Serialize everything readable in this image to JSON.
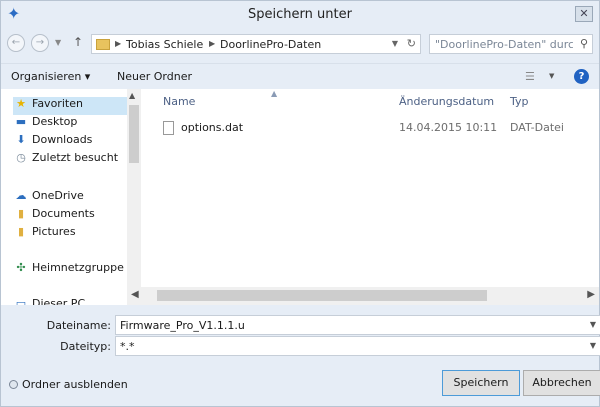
{
  "window": {
    "title": "Speichern unter",
    "close_glyph": "✕"
  },
  "nav": {
    "back_glyph": "←",
    "forward_glyph": "→",
    "up_glyph": "↑",
    "crumbs": [
      "Tobias Schiele",
      "DoorlinePro-Daten"
    ],
    "search_placeholder": "\"DoorlinePro-Daten\" durchsuc..."
  },
  "toolbar": {
    "organize_label": "Organisieren ▾",
    "new_folder_label": "Neuer Ordner"
  },
  "sidebar": {
    "items": [
      {
        "label": "Favoriten",
        "icon": "star-icon",
        "selected": true
      },
      {
        "label": "Desktop",
        "icon": "desktop-icon"
      },
      {
        "label": "Downloads",
        "icon": "downloads-icon"
      },
      {
        "label": "Zuletzt besucht",
        "icon": "recent-icon"
      },
      {
        "label": "OneDrive",
        "icon": "cloud-icon"
      },
      {
        "label": "Documents",
        "icon": "folder-icon"
      },
      {
        "label": "Pictures",
        "icon": "folder-icon"
      },
      {
        "label": "Heimnetzgruppe",
        "icon": "homegroup-icon"
      },
      {
        "label": "Dieser PC",
        "icon": "computer-icon"
      }
    ]
  },
  "files": {
    "columns": {
      "name": "Name",
      "date": "Änderungsdatum",
      "type": "Typ"
    },
    "rows": [
      {
        "name": "options.dat",
        "date": "14.04.2015 10:11",
        "type": "DAT-Datei"
      }
    ]
  },
  "form": {
    "filename_label": "Dateiname:",
    "filename_value": "Firmware_Pro_V1.1.1.u",
    "filetype_label": "Dateityp:",
    "filetype_value": "*.*"
  },
  "footer": {
    "hide_folders_label": "Ordner ausblenden",
    "save_label": "Speichern",
    "cancel_label": "Abbrechen"
  },
  "colors": {
    "accent": "#2062c2",
    "chrome": "#e6edf6",
    "selection": "#cde6f7"
  }
}
